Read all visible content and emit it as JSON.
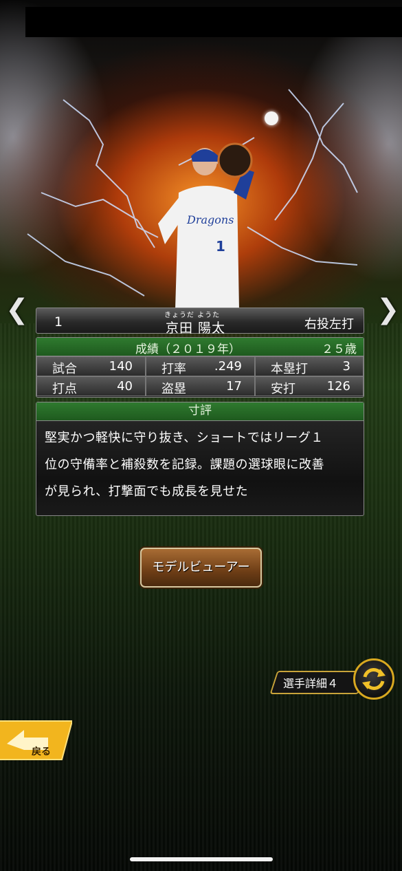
{
  "nav": {
    "prev_glyph": "❮",
    "next_glyph": "❯"
  },
  "player": {
    "number": "1",
    "furigana": "きょうだ ようた",
    "name": "京田 陽太",
    "handedness": "右投左打",
    "jersey_text": "Dragons",
    "jersey_number": "1"
  },
  "stats": {
    "header": "成績（２０１９年）",
    "age": "２５歳",
    "cells": [
      {
        "label": "試合",
        "value": "140"
      },
      {
        "label": "打率",
        "value": ".249"
      },
      {
        "label": "本塁打",
        "value": "3"
      },
      {
        "label": "打点",
        "value": "40"
      },
      {
        "label": "盗塁",
        "value": "17"
      },
      {
        "label": "安打",
        "value": "126"
      }
    ]
  },
  "review": {
    "header": "寸評",
    "lines": [
      "堅実かつ軽快に守り抜き、ショートではリーグ１",
      "位の守備率と補殺数を記録。課題の選球眼に改善",
      "が見られ、打撃面でも成長を見せた"
    ]
  },
  "buttons": {
    "model_viewer": "モデルビューアー",
    "player_detail": "選手詳細４",
    "back": "戻る"
  },
  "colors": {
    "panel_header": "#1e5a1e",
    "accent_gold": "#d8a820",
    "back_button": "#f2b51e"
  },
  "icons": {
    "cycle": "cycle-arrows-icon",
    "back": "back-arrow-icon"
  }
}
